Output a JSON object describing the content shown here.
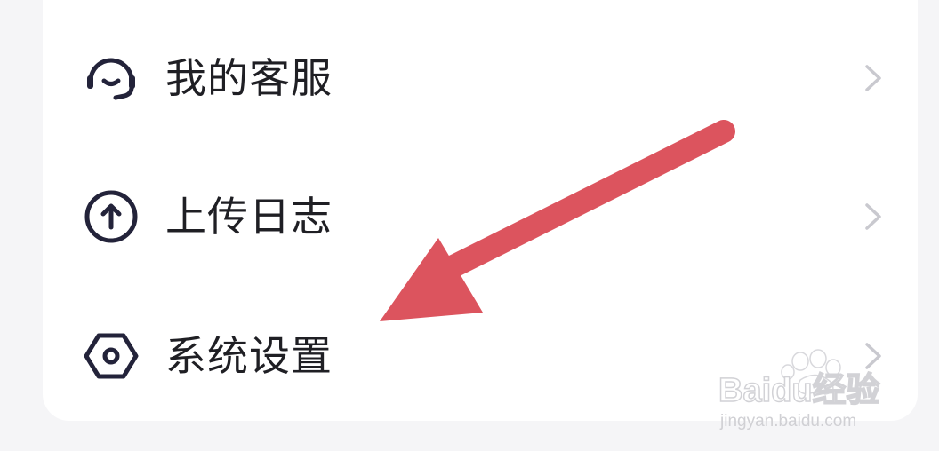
{
  "menu": {
    "items": [
      {
        "label": "我的客服",
        "icon": "customer-service-headset-icon"
      },
      {
        "label": "上传日志",
        "icon": "upload-arrow-circle-icon"
      },
      {
        "label": "系统设置",
        "icon": "settings-hexagon-icon"
      }
    ]
  },
  "watermark": {
    "brand": "Baidu经验",
    "url": "jingyan.baidu.com"
  },
  "colors": {
    "background": "#f5f5f7",
    "card": "#ffffff",
    "text": "#1f1f24",
    "icon_stroke": "#23233a",
    "chevron": "#c9c9cf",
    "arrow": "#dc545e"
  }
}
